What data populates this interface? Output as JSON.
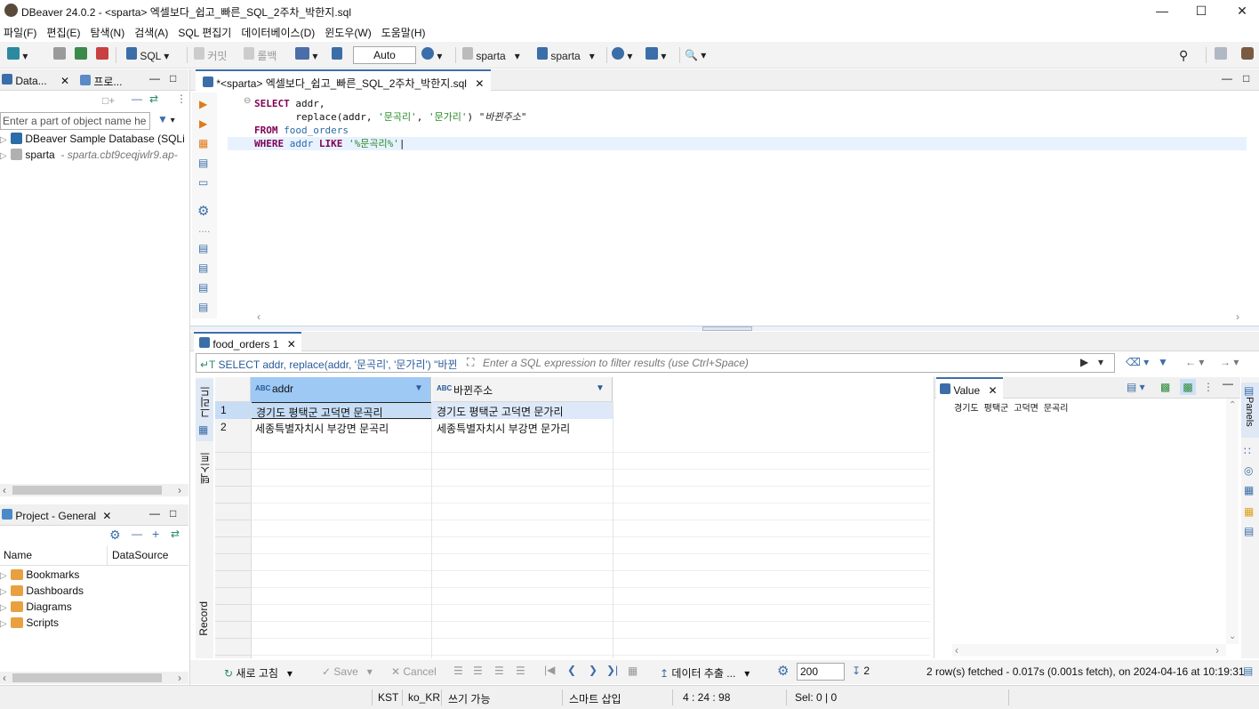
{
  "window": {
    "title": "DBeaver 24.0.2 - <sparta> 엑셀보다_쉽고_빠른_SQL_2주차_박한지.sql"
  },
  "menu": [
    "파일(F)",
    "편집(E)",
    "탐색(N)",
    "검색(A)",
    "SQL 편집기",
    "데이터베이스(D)",
    "윈도우(W)",
    "도움말(H)"
  ],
  "toolbar": {
    "sql_label": "SQL",
    "commit_label": "커밋",
    "rollback_label": "롤백",
    "tx_mode": "Auto",
    "datasource": "sparta",
    "schema": "sparta"
  },
  "left_panel": {
    "tab_navigator": "Data...",
    "tab_projects": "프로...",
    "filter_placeholder": "Enter a part of object name he",
    "tree": [
      {
        "label": "DBeaver Sample Database (SQLi",
        "detail": ""
      },
      {
        "label": "sparta",
        "detail": "- sparta.cbt9ceqjwlr9.ap-"
      }
    ]
  },
  "project_panel": {
    "title": "Project - General",
    "col_name": "Name",
    "col_datasource": "DataSource",
    "items": [
      "Bookmarks",
      "Dashboards",
      "Diagrams",
      "Scripts"
    ]
  },
  "editor": {
    "tab_title": "*<sparta> 엑셀보다_쉽고_빠른_SQL_2주차_박한지.sql",
    "lines": [
      {
        "kw": "SELECT",
        "rest": " addr,"
      },
      {
        "kw": "",
        "rest": "       replace(addr, '문곡리', '문가리') \"바뀐주소\""
      },
      {
        "kw": "FROM",
        "rest": " food_orders"
      },
      {
        "kw": "WHERE",
        "rest": " addr LIKE '%문곡리%'"
      }
    ]
  },
  "results": {
    "tab_title": "food_orders 1",
    "query_preview": "SELECT addr, replace(addr, '문곡리', '문가리') \"바뀐",
    "filter_placeholder": "Enter a SQL expression to filter results (use Ctrl+Space)",
    "columns": [
      "addr",
      "바뀐주소"
    ],
    "rows": [
      {
        "num": "1",
        "addr": "경기도 평택군 고덕면 문곡리",
        "new_addr": "경기도 평택군 고덕면 문가리"
      },
      {
        "num": "2",
        "addr": "세종특별자치시 부강면 문곡리",
        "new_addr": "세종특별자치시 부강면 문가리"
      }
    ],
    "side_tabs": {
      "grid": "그리드",
      "text": "텍스트",
      "record": "Record"
    },
    "value_panel": {
      "title": "Value",
      "content": "경기도 평택군 고덕면 문곡리"
    },
    "panels_label": "Panels",
    "bottom": {
      "refresh": "새로 고침",
      "save": "Save",
      "cancel": "Cancel",
      "export": "데이터 추출 ...",
      "fetch_size": "200",
      "count": "2",
      "status": "2 row(s) fetched - 0.017s (0.001s fetch), on 2024-04-16 at 10:19:31"
    }
  },
  "statusbar": {
    "tz": "KST",
    "locale": "ko_KR",
    "mode": "쓰기 가능",
    "insert": "스마트 삽입",
    "pos": "4 : 24 : 98",
    "sel": "Sel: 0 | 0"
  }
}
